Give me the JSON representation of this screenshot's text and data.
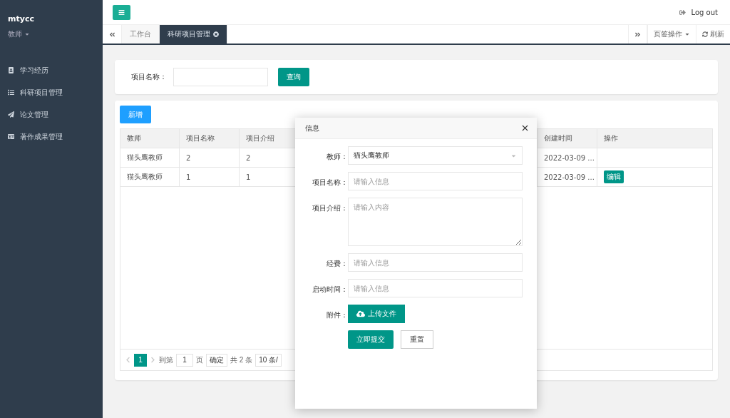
{
  "sidebar": {
    "user": "mtycc",
    "role": "教师",
    "items": [
      {
        "label": "学习经历",
        "selected": false
      },
      {
        "label": "科研项目管理",
        "selected": false
      },
      {
        "label": "论文管理",
        "selected": false
      },
      {
        "label": "著作成果管理",
        "selected": false
      }
    ]
  },
  "header": {
    "logout": "Log out"
  },
  "tabs": {
    "items": [
      {
        "label": "工作台",
        "selected": false,
        "closable": false
      },
      {
        "label": "科研项目管理",
        "selected": true,
        "closable": true
      }
    ],
    "tab_ops": "页签操作",
    "refresh": "刷新"
  },
  "search": {
    "label": "项目名称：",
    "button": "查询"
  },
  "table": {
    "add_button": "新增",
    "columns": [
      "教师",
      "项目名称",
      "项目介绍",
      "创建时间",
      "操作"
    ],
    "rows": [
      {
        "cells": [
          "猫头鹰教师",
          "2",
          "2",
          "2022-03-09 ..."
        ],
        "action": ""
      },
      {
        "cells": [
          "猫头鹰教师",
          "1",
          "1",
          "2022-03-09 ..."
        ],
        "action": "编辑"
      }
    ]
  },
  "pagination": {
    "current": "1",
    "goto_label": "到第",
    "goto_value": "1",
    "page_label": "页",
    "confirm": "确定",
    "total": "共 2 条",
    "page_size": "10 条/"
  },
  "dialog": {
    "title": "信息",
    "fields": [
      {
        "kind": "select",
        "label": "教师：",
        "value": "猫头鹰教师"
      },
      {
        "kind": "input",
        "label": "项目名称：",
        "placeholder": "请输入信息"
      },
      {
        "kind": "textarea",
        "label": "项目介绍：",
        "placeholder": "请输入内容"
      },
      {
        "kind": "input",
        "label": "经费：",
        "placeholder": "请输入信息"
      },
      {
        "kind": "input",
        "label": "启动时间：",
        "placeholder": "请输入信息"
      },
      {
        "kind": "upload",
        "label": "附件：",
        "button": "上传文件"
      }
    ],
    "submit": "立即提交",
    "reset": "重置"
  }
}
